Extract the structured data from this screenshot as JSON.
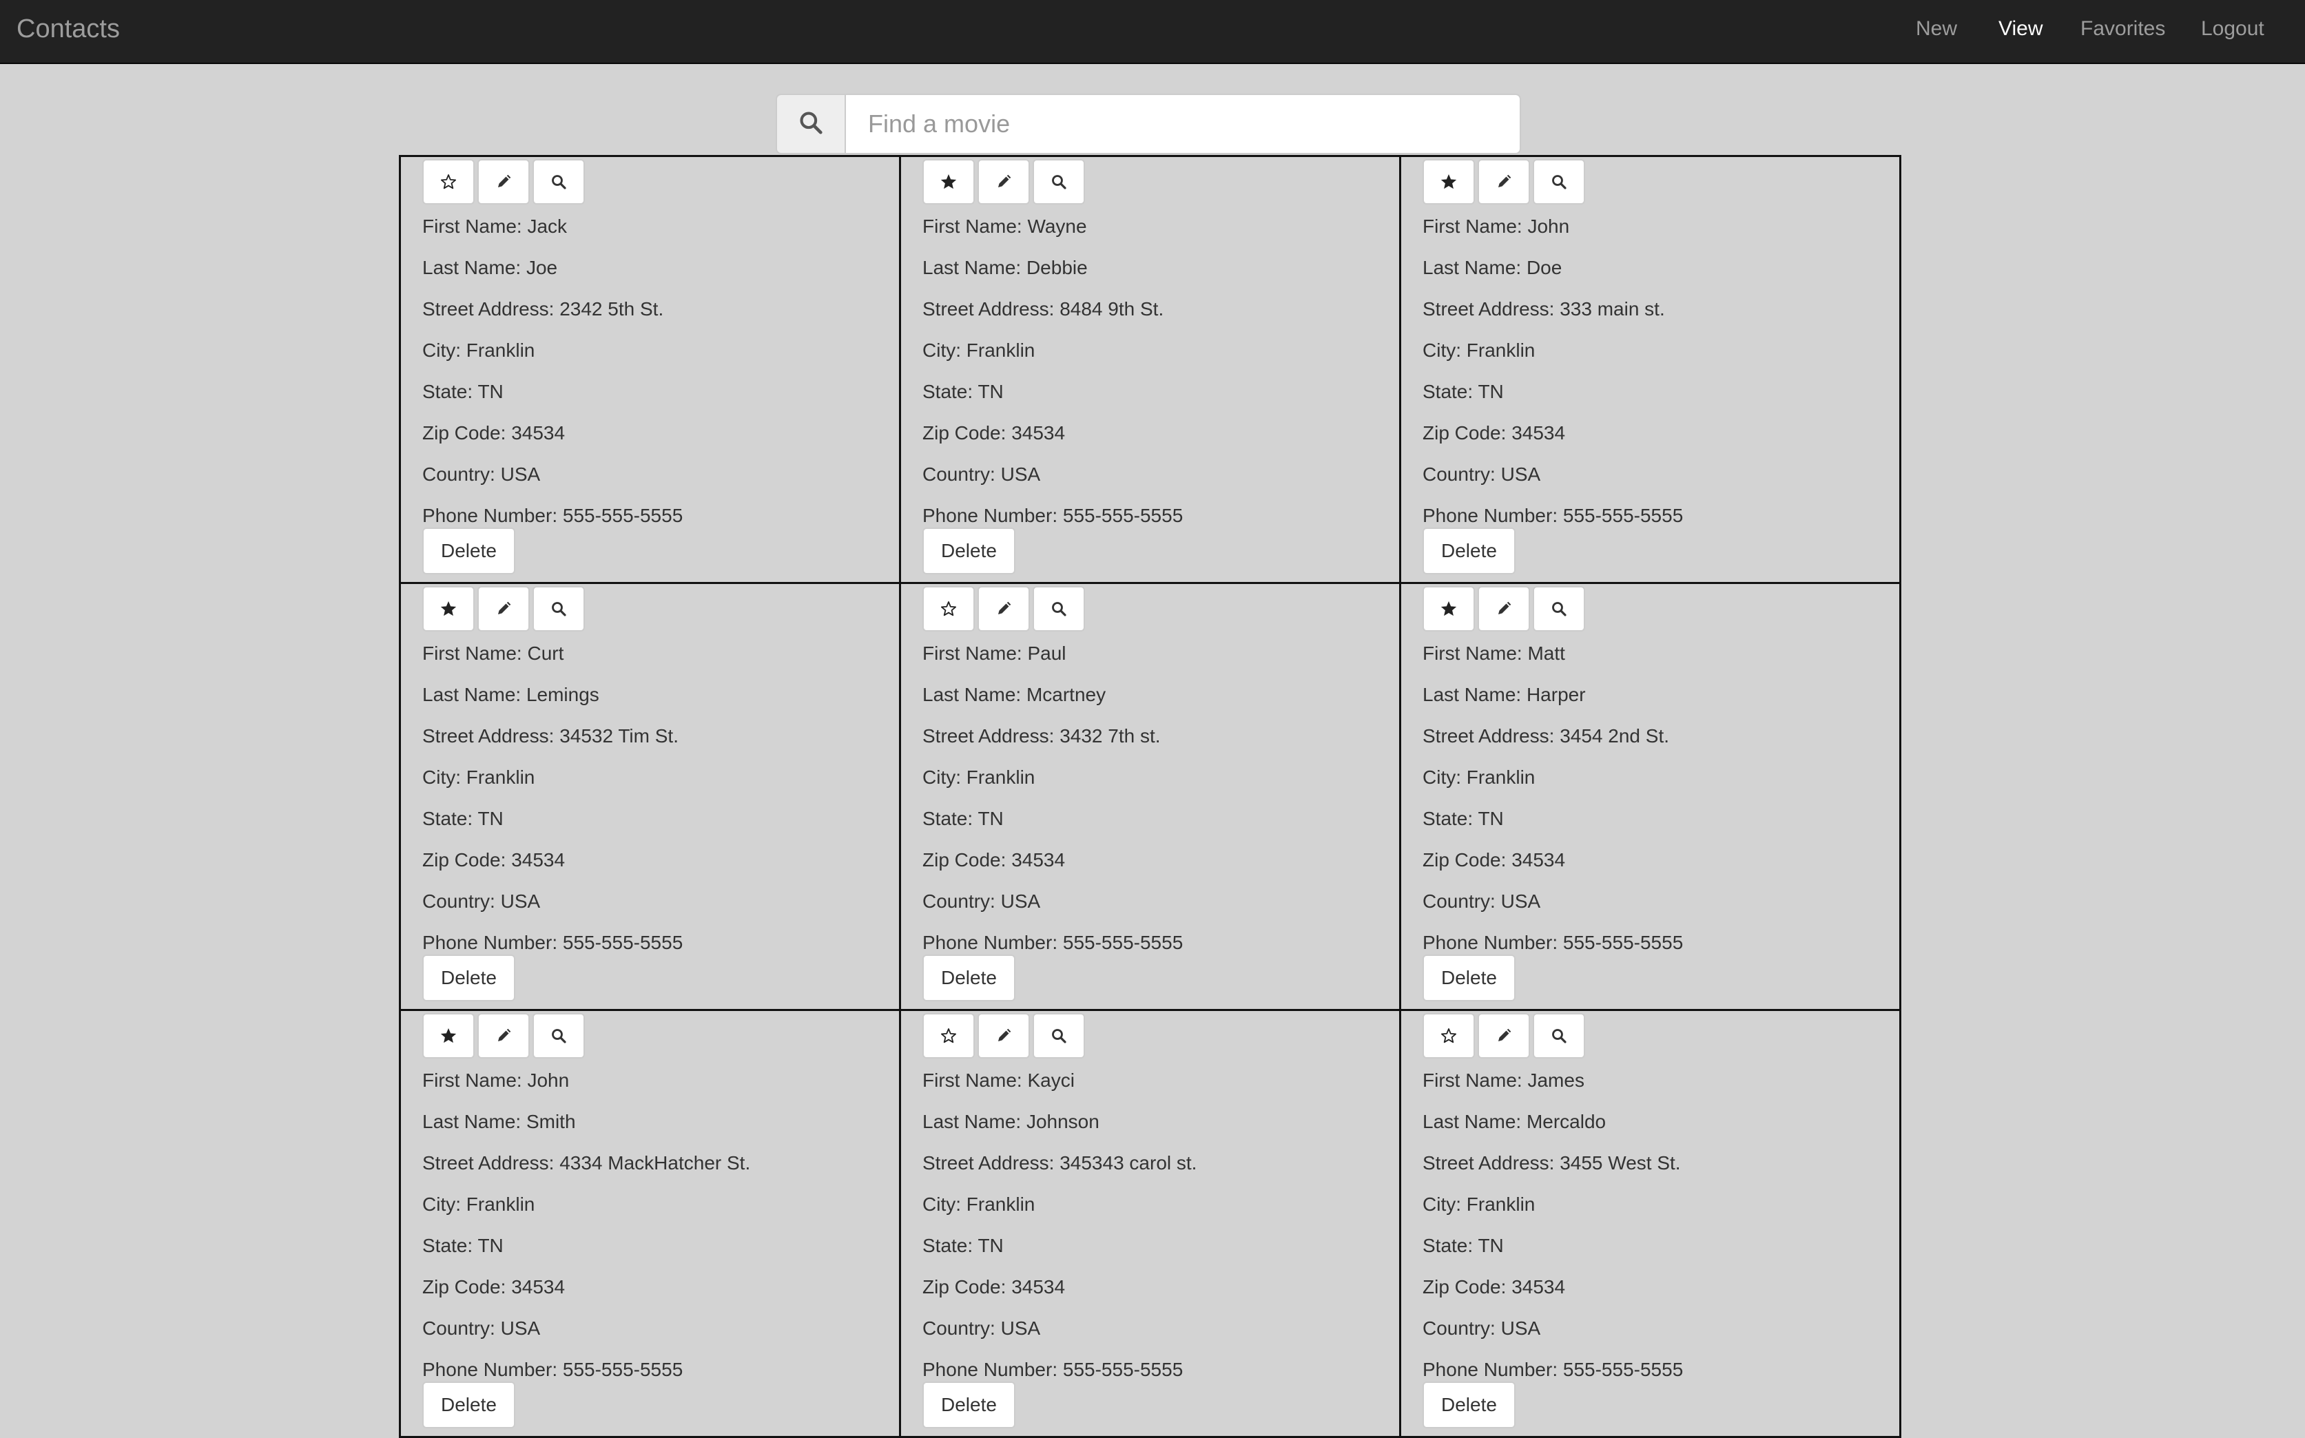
{
  "navbar": {
    "brand": "Contacts",
    "items": [
      {
        "label": "New",
        "active": false
      },
      {
        "label": "View",
        "active": true
      },
      {
        "label": "Favorites",
        "active": false
      },
      {
        "label": "Logout",
        "active": false
      }
    ]
  },
  "search": {
    "icon": "search-icon",
    "placeholder": "Find a movie",
    "value": ""
  },
  "labels": {
    "first_name": "First Name:",
    "last_name": "Last Name:",
    "street_address": "Street Address:",
    "city": "City:",
    "state": "State:",
    "zip_code": "Zip Code:",
    "country": "Country:",
    "phone_number": "Phone Number:",
    "delete": "Delete"
  },
  "contacts": [
    {
      "favorite": false,
      "first_name": "Jack",
      "last_name": "Joe",
      "street_address": "2342 5th St.",
      "city": "Franklin",
      "state": "TN",
      "zip_code": "34534",
      "country": "USA",
      "phone_number": "555-555-5555"
    },
    {
      "favorite": true,
      "first_name": "Wayne",
      "last_name": "Debbie",
      "street_address": "8484 9th St.",
      "city": "Franklin",
      "state": "TN",
      "zip_code": "34534",
      "country": "USA",
      "phone_number": "555-555-5555"
    },
    {
      "favorite": true,
      "first_name": "John",
      "last_name": "Doe",
      "street_address": "333 main st.",
      "city": "Franklin",
      "state": "TN",
      "zip_code": "34534",
      "country": "USA",
      "phone_number": "555-555-5555"
    },
    {
      "favorite": true,
      "first_name": "Curt",
      "last_name": "Lemings",
      "street_address": "34532 Tim St.",
      "city": "Franklin",
      "state": "TN",
      "zip_code": "34534",
      "country": "USA",
      "phone_number": "555-555-5555"
    },
    {
      "favorite": false,
      "first_name": "Paul",
      "last_name": "Mcartney",
      "street_address": "3432 7th st.",
      "city": "Franklin",
      "state": "TN",
      "zip_code": "34534",
      "country": "USA",
      "phone_number": "555-555-5555"
    },
    {
      "favorite": true,
      "first_name": "Matt",
      "last_name": "Harper",
      "street_address": "3454 2nd St.",
      "city": "Franklin",
      "state": "TN",
      "zip_code": "34534",
      "country": "USA",
      "phone_number": "555-555-5555"
    },
    {
      "favorite": true,
      "first_name": "John",
      "last_name": "Smith",
      "street_address": "4334 MackHatcher St.",
      "city": "Franklin",
      "state": "TN",
      "zip_code": "34534",
      "country": "USA",
      "phone_number": "555-555-5555"
    },
    {
      "favorite": false,
      "first_name": "Kayci",
      "last_name": "Johnson",
      "street_address": "345343 carol st.",
      "city": "Franklin",
      "state": "TN",
      "zip_code": "34534",
      "country": "USA",
      "phone_number": "555-555-5555"
    },
    {
      "favorite": false,
      "first_name": "James",
      "last_name": "Mercaldo",
      "street_address": "3455 West St.",
      "city": "Franklin",
      "state": "TN",
      "zip_code": "34534",
      "country": "USA",
      "phone_number": "555-555-5555"
    }
  ],
  "icons": {
    "favorite_on": "star-filled-icon",
    "favorite_off": "star-outline-icon",
    "edit": "pencil-icon",
    "details": "search-icon"
  }
}
